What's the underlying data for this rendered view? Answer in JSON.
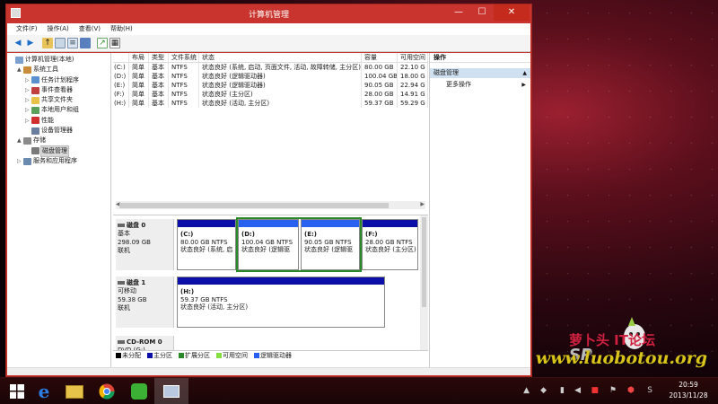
{
  "window": {
    "title": "计算机管理"
  },
  "menu": [
    "文件(F)",
    "操作(A)",
    "查看(V)",
    "帮助(H)"
  ],
  "tree": [
    {
      "label": "计算机管理(本地)",
      "indent": 0,
      "arrow": "",
      "icon": "computer-icon"
    },
    {
      "label": "系统工具",
      "indent": 1,
      "arrow": "▲",
      "icon": "tools-icon"
    },
    {
      "label": "任务计划程序",
      "indent": 2,
      "arrow": "▷",
      "icon": "task-scheduler-icon"
    },
    {
      "label": "事件查看器",
      "indent": 2,
      "arrow": "▷",
      "icon": "event-viewer-icon"
    },
    {
      "label": "共享文件夹",
      "indent": 2,
      "arrow": "▷",
      "icon": "shared-folder-icon"
    },
    {
      "label": "本地用户和组",
      "indent": 2,
      "arrow": "▷",
      "icon": "users-icon"
    },
    {
      "label": "性能",
      "indent": 2,
      "arrow": "▷",
      "icon": "performance-icon"
    },
    {
      "label": "设备管理器",
      "indent": 2,
      "arrow": "",
      "icon": "device-manager-icon"
    },
    {
      "label": "存储",
      "indent": 1,
      "arrow": "▲",
      "icon": "storage-icon"
    },
    {
      "label": "磁盘管理",
      "indent": 2,
      "arrow": "",
      "icon": "disk-icon",
      "selected": true
    },
    {
      "label": "服务和应用程序",
      "indent": 1,
      "arrow": "▷",
      "icon": "services-icon"
    }
  ],
  "volumes": {
    "headers": [
      "",
      "布局",
      "类型",
      "文件系统",
      "状态",
      "容量",
      "可用空间"
    ],
    "rows": [
      [
        "(C:)",
        "简单",
        "基本",
        "NTFS",
        "状态良好 (系统, 启动, 页面文件, 活动, 故障转储, 主分区)",
        "80.00 GB",
        "22.10 G"
      ],
      [
        "(D:)",
        "简单",
        "基本",
        "NTFS",
        "状态良好 (逻辑驱动器)",
        "100.04 GB",
        "18.00 G"
      ],
      [
        "(E:)",
        "简单",
        "基本",
        "NTFS",
        "状态良好 (逻辑驱动器)",
        "90.05 GB",
        "22.94 G"
      ],
      [
        "(F:)",
        "简单",
        "基本",
        "NTFS",
        "状态良好 (主分区)",
        "28.00 GB",
        "14.91 G"
      ],
      [
        "(H:)",
        "简单",
        "基本",
        "NTFS",
        "状态良好 (活动, 主分区)",
        "59.37 GB",
        "59.29 G"
      ]
    ]
  },
  "disks": [
    {
      "name": "磁盘 0",
      "type": "基本",
      "size": "298.09 GB",
      "status": "联机",
      "partitions": [
        {
          "name": "(C:)",
          "size": "80.00 GB NTFS",
          "status": "状态良好 (系统, 启",
          "kind": "primary"
        },
        {
          "name": "(D:)",
          "size": "100.04 GB NTFS",
          "status": "状态良好 (逻辑驱",
          "kind": "logical"
        },
        {
          "name": "(E:)",
          "size": "90.05 GB NTFS",
          "status": "状态良好 (逻辑驱",
          "kind": "logical"
        },
        {
          "name": "(F:)",
          "size": "28.00 GB NTFS",
          "status": "状态良好 (主分区)",
          "kind": "primary"
        }
      ]
    },
    {
      "name": "磁盘 1",
      "type": "可移动",
      "size": "59.38 GB",
      "status": "联机",
      "partitions": [
        {
          "name": "(H:)",
          "size": "59.37 GB NTFS",
          "status": "状态良好 (活动, 主分区)",
          "kind": "primary"
        }
      ]
    },
    {
      "name": "CD-ROM 0",
      "type": "DVD (G:)",
      "size": "",
      "status": "",
      "partitions": []
    }
  ],
  "legend": [
    {
      "label": "未分配",
      "color": "#000000"
    },
    {
      "label": "主分区",
      "color": "#0b0fa8"
    },
    {
      "label": "扩展分区",
      "color": "#2a8a2a"
    },
    {
      "label": "可用空间",
      "color": "#88dd44"
    },
    {
      "label": "逻辑驱动器",
      "color": "#2860f0"
    }
  ],
  "actions": {
    "header": "操作",
    "section": "磁盘管理",
    "item": "更多操作"
  },
  "watermark": {
    "site": "www.luobotou.org",
    "forum": "萝卜头 IT论坛",
    "sp": "SP"
  },
  "clock": {
    "time": "20:59",
    "date": "2013/11/28"
  },
  "colors": {
    "title_bar": "#c9352e",
    "primary_partition": "#0b0fa8",
    "logical_drive": "#2860f0",
    "extended_partition": "#2a8a2a"
  }
}
